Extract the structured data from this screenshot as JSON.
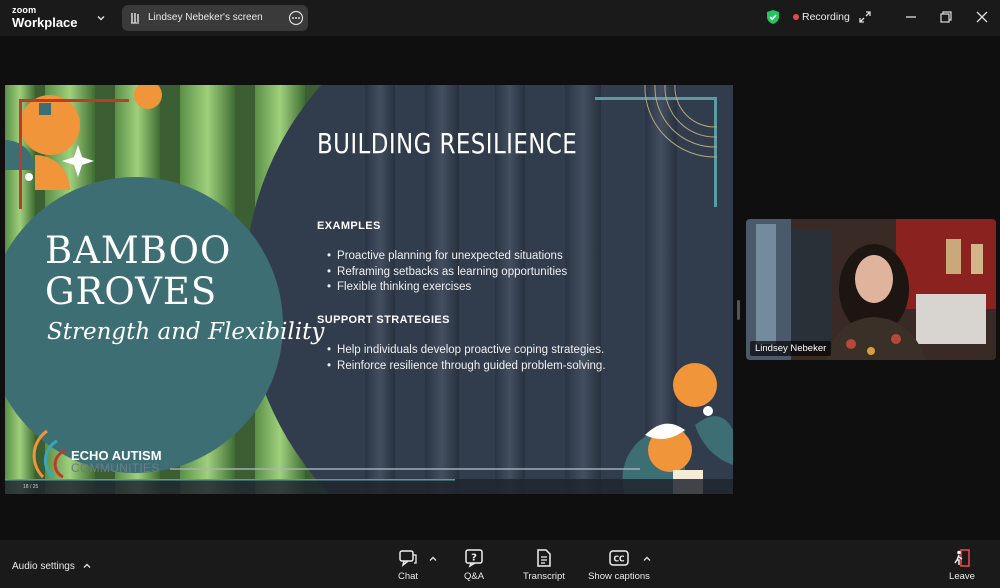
{
  "app": {
    "brand_top": "zoom",
    "brand_bottom": "Workplace"
  },
  "share": {
    "label": "Lindsey Nebeker's screen"
  },
  "status": {
    "recording_label": "Recording"
  },
  "slide": {
    "left_title_line1": "BAMBOO",
    "left_title_line2": "GROVES",
    "left_subtitle": "Strength and Flexibility",
    "heading": "BUILDING RESILIENCE",
    "section1": "EXAMPLES",
    "examples": [
      "Proactive planning for unexpected situations",
      "Reframing setbacks as learning opportunities",
      "Flexible thinking exercises"
    ],
    "section2": "SUPPORT STRATEGIES",
    "strategies": [
      "Help individuals develop proactive coping strategies.",
      "Reinforce resilience through guided problem-solving."
    ],
    "logo_line1": "ECHO AUTISM",
    "logo_line2": "COMMUNITIES",
    "page_indicator": "18 / 25"
  },
  "participant": {
    "name": "Lindsey Nebeker"
  },
  "toolbar": {
    "audio_settings": "Audio settings",
    "chat": "Chat",
    "qa": "Q&A",
    "transcript": "Transcript",
    "captions": "Show captions",
    "leave": "Leave"
  },
  "colors": {
    "accent_orange": "#f0953a",
    "teal": "#3d6e74",
    "record_red": "#e5484d",
    "shield_green": "#22c55e"
  }
}
